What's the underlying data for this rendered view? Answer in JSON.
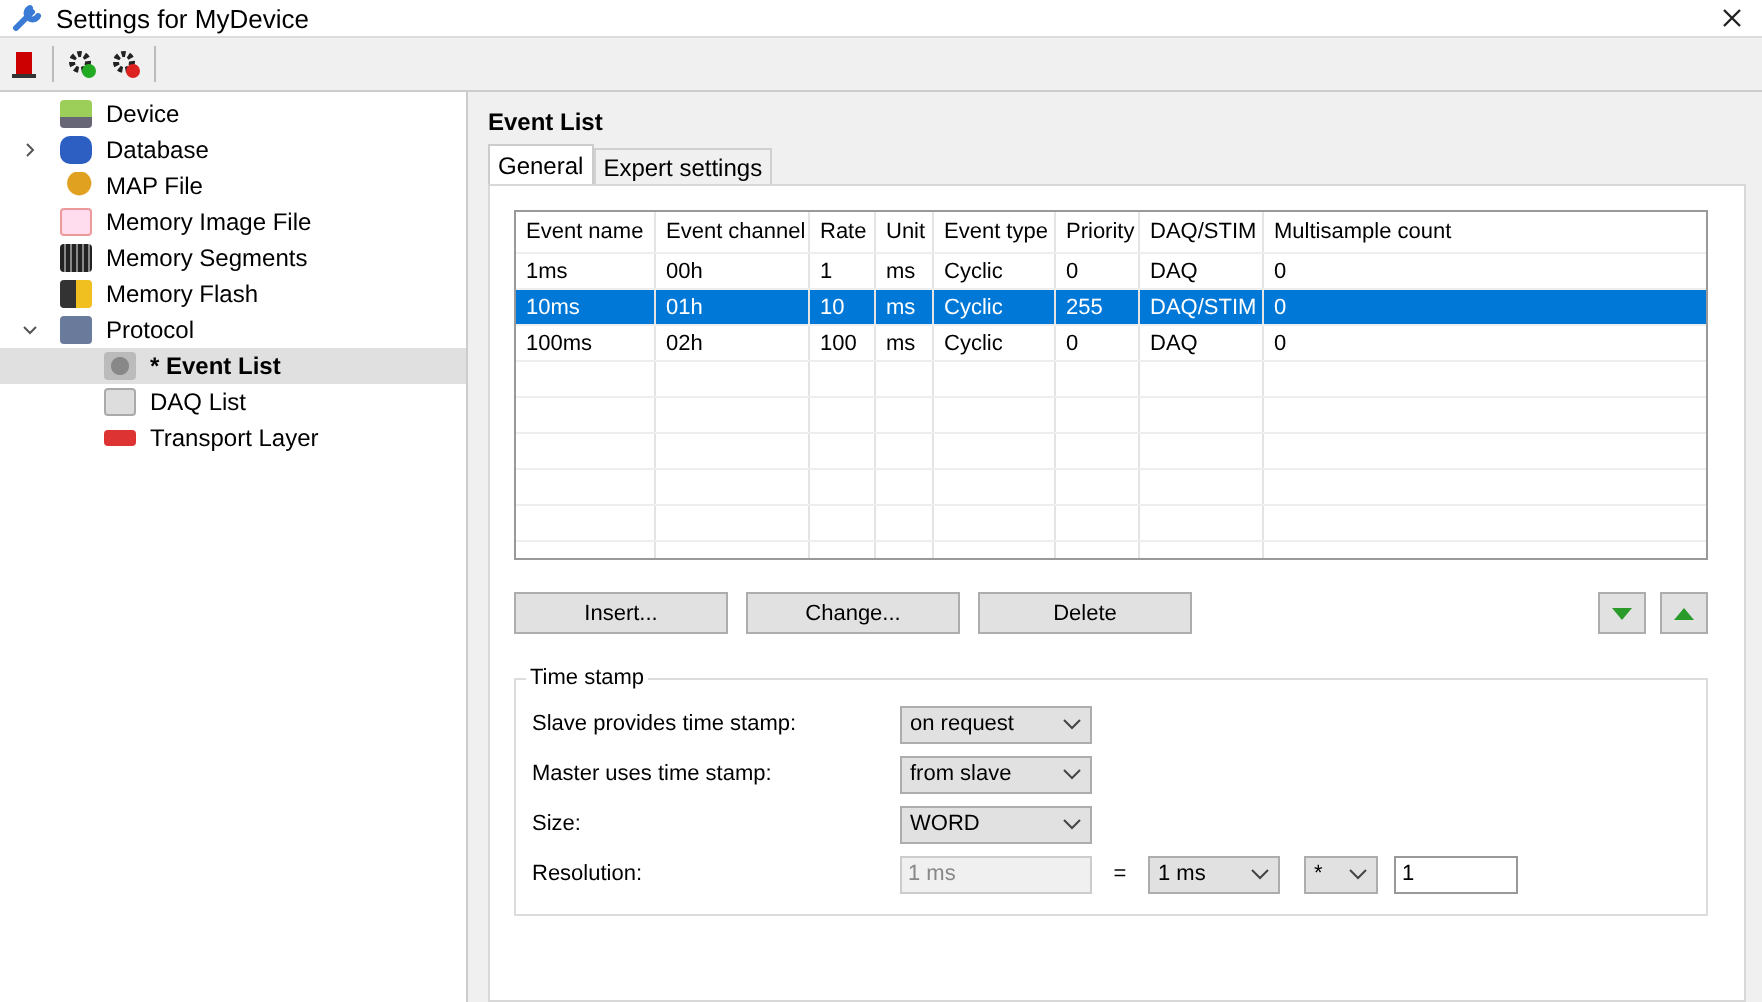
{
  "window": {
    "title": "Settings for MyDevice"
  },
  "tree": [
    {
      "label": "Device",
      "selected": false
    },
    {
      "label": "Database",
      "selected": false,
      "expanded": false
    },
    {
      "label": "MAP File",
      "selected": false
    },
    {
      "label": "Memory Image File",
      "selected": false
    },
    {
      "label": "Memory Segments",
      "selected": false
    },
    {
      "label": "Memory Flash",
      "selected": false
    },
    {
      "label": "Protocol",
      "selected": false,
      "expanded": true,
      "children": [
        {
          "label": "* Event List",
          "selected": true
        },
        {
          "label": "DAQ List",
          "selected": false
        },
        {
          "label": "Transport Layer",
          "selected": false
        }
      ]
    }
  ],
  "panel": {
    "title": "Event List"
  },
  "tabs": [
    {
      "label": "General",
      "selected": true
    },
    {
      "label": "Expert settings",
      "selected": false
    }
  ],
  "table": {
    "columns": [
      "Event name",
      "Event channel",
      "Rate",
      "Unit",
      "Event type",
      "Priority",
      "DAQ/STIM",
      "Multisample count"
    ],
    "rows": [
      {
        "cells": [
          "1ms",
          "00h",
          "1",
          "ms",
          "Cyclic",
          "0",
          "DAQ",
          "0"
        ],
        "selected": false
      },
      {
        "cells": [
          "10ms",
          "01h",
          "10",
          "ms",
          "Cyclic",
          "255",
          "DAQ/STIM",
          "0"
        ],
        "selected": true
      },
      {
        "cells": [
          "100ms",
          "02h",
          "100",
          "ms",
          "Cyclic",
          "0",
          "DAQ",
          "0"
        ],
        "selected": false
      }
    ]
  },
  "buttons": [
    "Insert...",
    "Change...",
    "Delete"
  ],
  "time_stamp": {
    "title": "Time stamp",
    "rows": [
      {
        "label": "Slave provides time stamp:",
        "value": "on request"
      },
      {
        "label": "Master uses time stamp:",
        "value": "from slave"
      },
      {
        "label": "Size:",
        "value": "WORD"
      }
    ],
    "resolution": {
      "label": "Resolution:",
      "value": "1 ms",
      "disabled": true,
      "equals": "=",
      "unit": "1 ms",
      "operator": "*",
      "factor": "1"
    }
  }
}
